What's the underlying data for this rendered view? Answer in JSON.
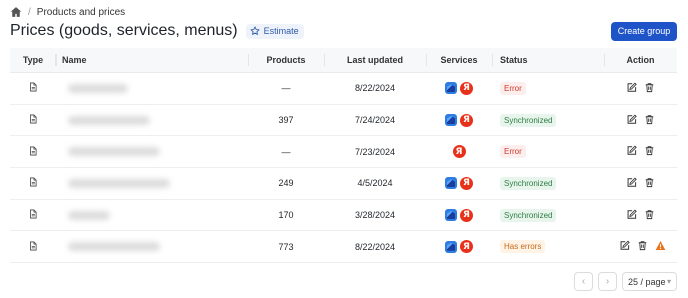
{
  "breadcrumb": {
    "home_icon": "home-icon",
    "separator": "/",
    "current": "Products and prices"
  },
  "header": {
    "title": "Prices (goods, services, menus)",
    "estimate_label": "Estimate",
    "create_label": "Create group"
  },
  "table": {
    "columns": {
      "type": "Type",
      "name": "Name",
      "products": "Products",
      "updated": "Last updated",
      "services": "Services",
      "status": "Status",
      "action": "Action"
    },
    "rows": [
      {
        "products": "—",
        "updated": "8/22/2024",
        "services": [
          "yandex-maps-icon",
          "yandex-icon"
        ],
        "status": "Error",
        "status_kind": "error"
      },
      {
        "products": "397",
        "updated": "7/24/2024",
        "services": [
          "yandex-maps-icon",
          "yandex-icon"
        ],
        "status": "Synchronized",
        "status_kind": "sync"
      },
      {
        "products": "—",
        "updated": "7/23/2024",
        "services": [
          "yandex-icon"
        ],
        "status": "Error",
        "status_kind": "error"
      },
      {
        "products": "249",
        "updated": "4/5/2024",
        "services": [
          "yandex-maps-icon",
          "yandex-icon"
        ],
        "status": "Synchronized",
        "status_kind": "sync"
      },
      {
        "products": "170",
        "updated": "3/28/2024",
        "services": [
          "yandex-maps-icon",
          "yandex-icon"
        ],
        "status": "Synchronized",
        "status_kind": "sync"
      },
      {
        "products": "773",
        "updated": "8/22/2024",
        "services": [
          "yandex-maps-icon",
          "yandex-icon"
        ],
        "status": "Has errors",
        "status_kind": "warn",
        "warning": true
      }
    ]
  },
  "pagination": {
    "page_size": "25 / page"
  },
  "colors": {
    "primary": "#1f54c9",
    "error": "#d1372b",
    "success": "#2e7d45",
    "warning": "#e8731b"
  }
}
